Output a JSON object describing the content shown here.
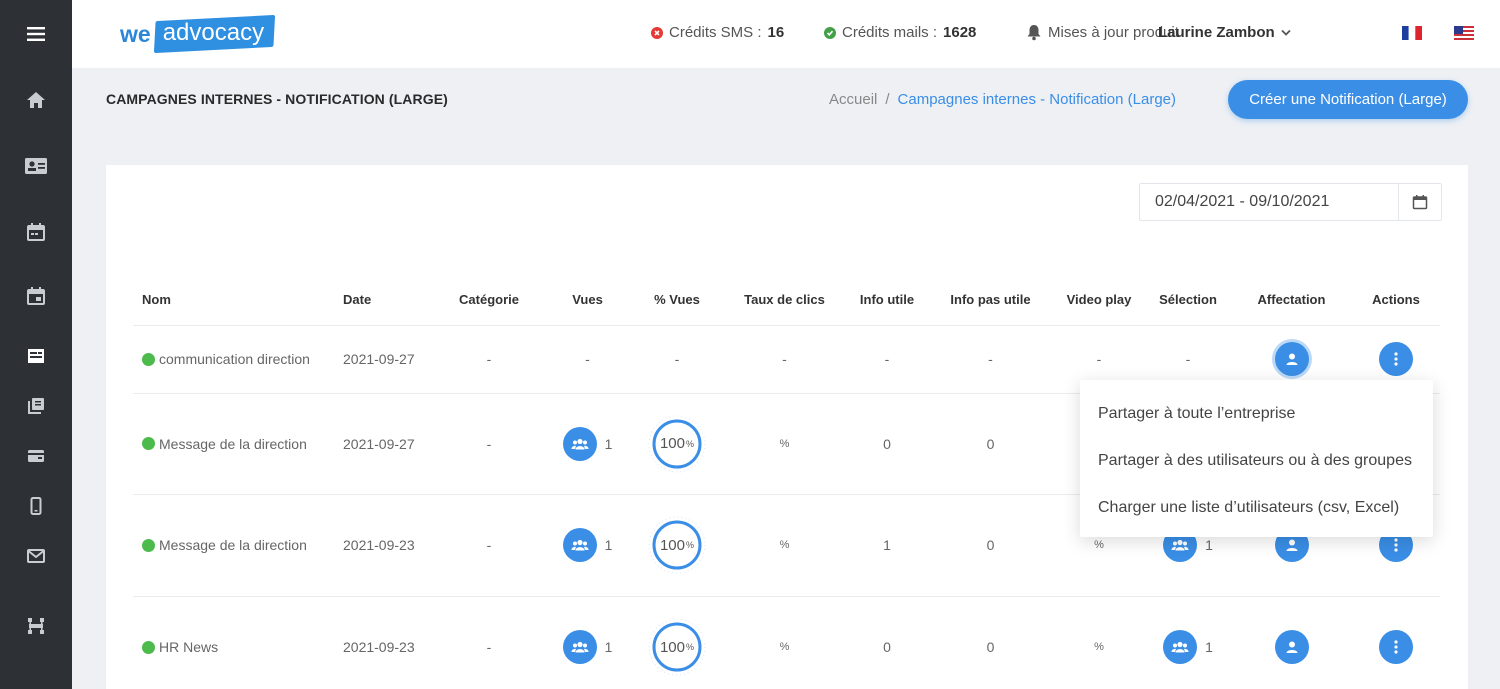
{
  "sidebar": {
    "icons": [
      "menu-icon",
      "home-icon",
      "contact-card-icon",
      "calendar-icon",
      "calendar-event-icon",
      "campaign-icon",
      "library-icon",
      "wallet-icon",
      "mobile-icon",
      "mail-icon",
      "network-icon"
    ]
  },
  "logo": {
    "we": "we",
    "advocacy": "advocacy"
  },
  "header": {
    "sms_label": "Crédits SMS :",
    "sms_value": "16",
    "sms_color": "#e53935",
    "mails_label": "Crédits mails :",
    "mails_value": "1628",
    "mails_color": "#43a047",
    "updates": "Mises à jour produit",
    "user": "Laurine Zambon",
    "languages": [
      "fr-flag-icon",
      "us-flag-icon"
    ]
  },
  "page": {
    "title": "CAMPAGNES INTERNES - NOTIFICATION (LARGE)",
    "breadcrumb_home": "Accueil",
    "breadcrumb_sep": "/",
    "breadcrumb_current": "Campagnes internes - Notification (Large)",
    "create_button": "Créer une Notification (Large)",
    "date_range": "02/04/2021 - 09/10/2021",
    "accent": "#3a8ee6"
  },
  "table": {
    "headers": [
      "Nom",
      "Date",
      "Catégorie",
      "Vues",
      "% Vues",
      "Taux de clics",
      "Info utile",
      "Info pas utile",
      "Video play",
      "Sélection",
      "Affectation",
      "Actions"
    ],
    "rows": [
      {
        "name": "communication direction",
        "date": "2021-09-27",
        "category": "-",
        "views": "-",
        "pct_views": "-",
        "ctr": "-",
        "useful": "-",
        "not_useful": "-",
        "video": "-",
        "selection": "-"
      },
      {
        "name": "Message de la direction",
        "date": "2021-09-27",
        "category": "-",
        "views": "1",
        "pct_views": "100",
        "pct_unit": "%",
        "ctr": "%",
        "useful": "0",
        "not_useful": "0",
        "video": "",
        "selection": ""
      },
      {
        "name": "Message de la direction",
        "date": "2021-09-23",
        "category": "-",
        "views": "1",
        "pct_views": "100",
        "pct_unit": "%",
        "ctr": "%",
        "useful": "1",
        "not_useful": "0",
        "video": "%",
        "selection": "1"
      },
      {
        "name": "HR News",
        "date": "2021-09-23",
        "category": "-",
        "views": "1",
        "pct_views": "100",
        "pct_unit": "%",
        "ctr": "%",
        "useful": "0",
        "not_useful": "0",
        "video": "%",
        "selection": "1"
      }
    ]
  },
  "dropdown": {
    "items": [
      "Partager à toute l’entreprise",
      "Partager à des utilisateurs ou à des groupes",
      "Charger une liste d’utilisateurs (csv, Excel)"
    ]
  }
}
